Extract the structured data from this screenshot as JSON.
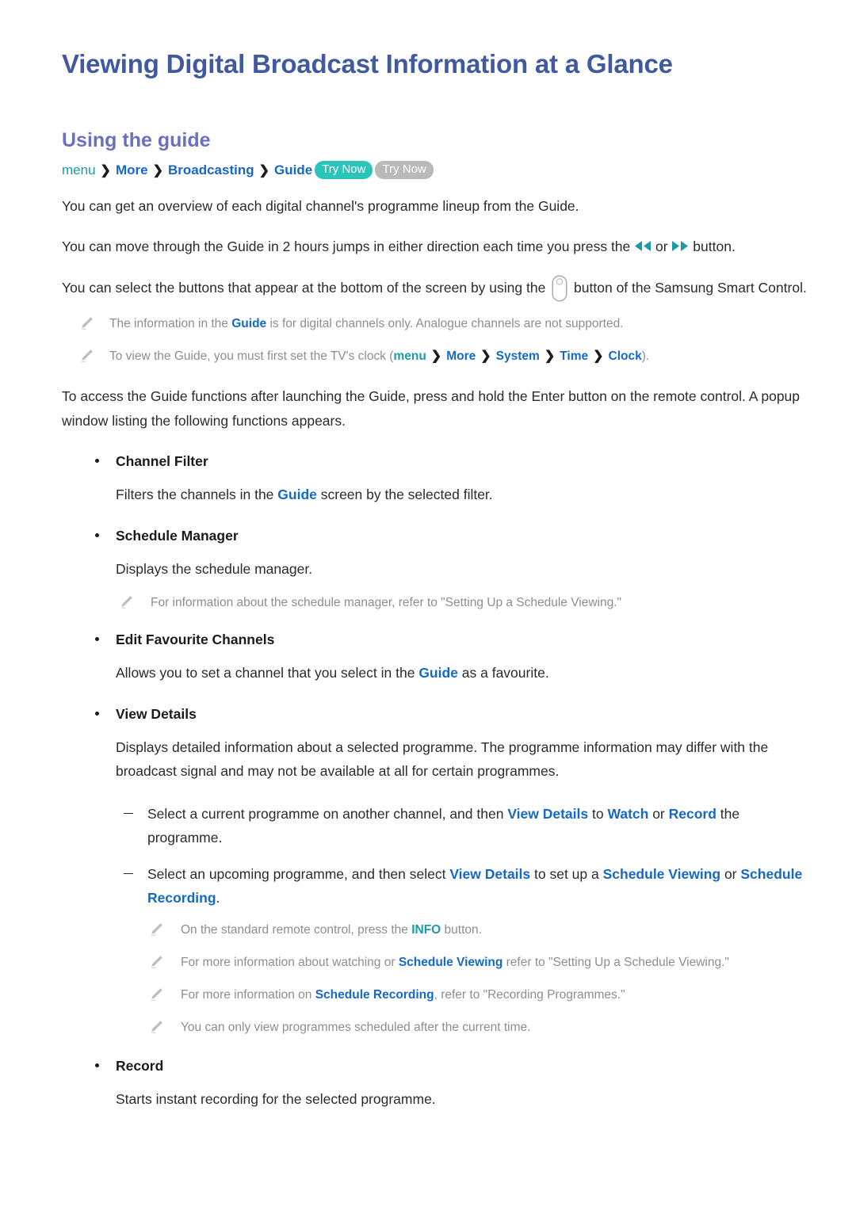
{
  "document": {
    "title": "Viewing Digital Broadcast Information at a Glance",
    "section_heading": "Using the guide"
  },
  "colors": {
    "title_blue": "#41599f",
    "heading_purple": "#6a6fc0",
    "link_blue": "#1668c8",
    "teal": "#1b9aa8",
    "pill_active": "#2bc4ba",
    "pill_inactive": "#b9b9b9",
    "note_gray": "#8e8e8e",
    "body_text": "#2b2b2b"
  },
  "breadcrumb": {
    "items": [
      "menu",
      "More",
      "Broadcasting",
      "Guide"
    ],
    "separator": "❯",
    "badges": [
      {
        "label": "Try Now",
        "state": "active"
      },
      {
        "label": "Try Now",
        "state": "inactive"
      }
    ]
  },
  "intro": {
    "p1": "You can get an overview of each digital channel's programme lineup from the Guide.",
    "p2_before": "You can move through the Guide in 2 hours jumps in either direction each time you press the ",
    "p2_or": " or ",
    "p2_after": " button.",
    "p3_before": "You can select the buttons that appear at the bottom of the screen by using the ",
    "p3_after": " button of the Samsung Smart Control."
  },
  "notes_top": [
    {
      "before": "The information in the ",
      "link": "Guide",
      "after": " is for digital channels only. Analogue channels are not supported."
    }
  ],
  "note_clock": {
    "before": "To view the Guide, you must first set the TV's clock (",
    "menu": "menu",
    "sep": "❯",
    "items": [
      "More",
      "System",
      "Time",
      "Clock"
    ],
    "after": ")."
  },
  "access": {
    "paragraph": "To access the Guide functions after launching the Guide, press and hold the Enter button on the remote control. A popup window listing the following functions appears."
  },
  "functions": {
    "channel_filter": {
      "label": "Channel Filter",
      "desc_before": "Filters the channels in the ",
      "desc_link": "Guide",
      "desc_after": " screen by the selected filter."
    },
    "schedule_manager": {
      "label": "Schedule Manager",
      "desc": "Displays the schedule manager.",
      "note": "For information about the schedule manager, refer to \"Setting Up a Schedule Viewing.\""
    },
    "edit_favourite": {
      "label": "Edit Favourite Channels",
      "desc_before": "Allows you to set a channel that you select in the ",
      "desc_link": "Guide",
      "desc_after": " as a favourite."
    },
    "view_details": {
      "label": "View Details",
      "desc": "Displays detailed information about a selected programme. The programme information may differ with the broadcast signal and may not be available at all for certain programmes.",
      "dash1": {
        "before": "Select a current programme on another channel, and then ",
        "link1": "View Details",
        "mid1": " to ",
        "link2": "Watch",
        "mid2": " or ",
        "link3": "Record",
        "after": " the programme."
      },
      "dash2": {
        "before": "Select an upcoming programme, and then select ",
        "link1": "View Details",
        "mid1": " to set up a ",
        "link2": "Schedule Viewing",
        "mid2": " or ",
        "link3": "Schedule Recording",
        "after": "."
      },
      "notes": {
        "n1_before": "On the standard remote control, press the ",
        "n1_link": "INFO",
        "n1_after": " button.",
        "n2_before": "For more information about watching or ",
        "n2_link": "Schedule Viewing",
        "n2_after": " refer to \"Setting Up a Schedule Viewing.\"",
        "n3_before": "For more information on ",
        "n3_link": "Schedule Recording",
        "n3_after": ", refer to \"Recording Programmes.\"",
        "n4": "You can only view programmes scheduled after the current time."
      }
    },
    "record": {
      "label": "Record",
      "desc": "Starts instant recording for the selected programme."
    }
  }
}
